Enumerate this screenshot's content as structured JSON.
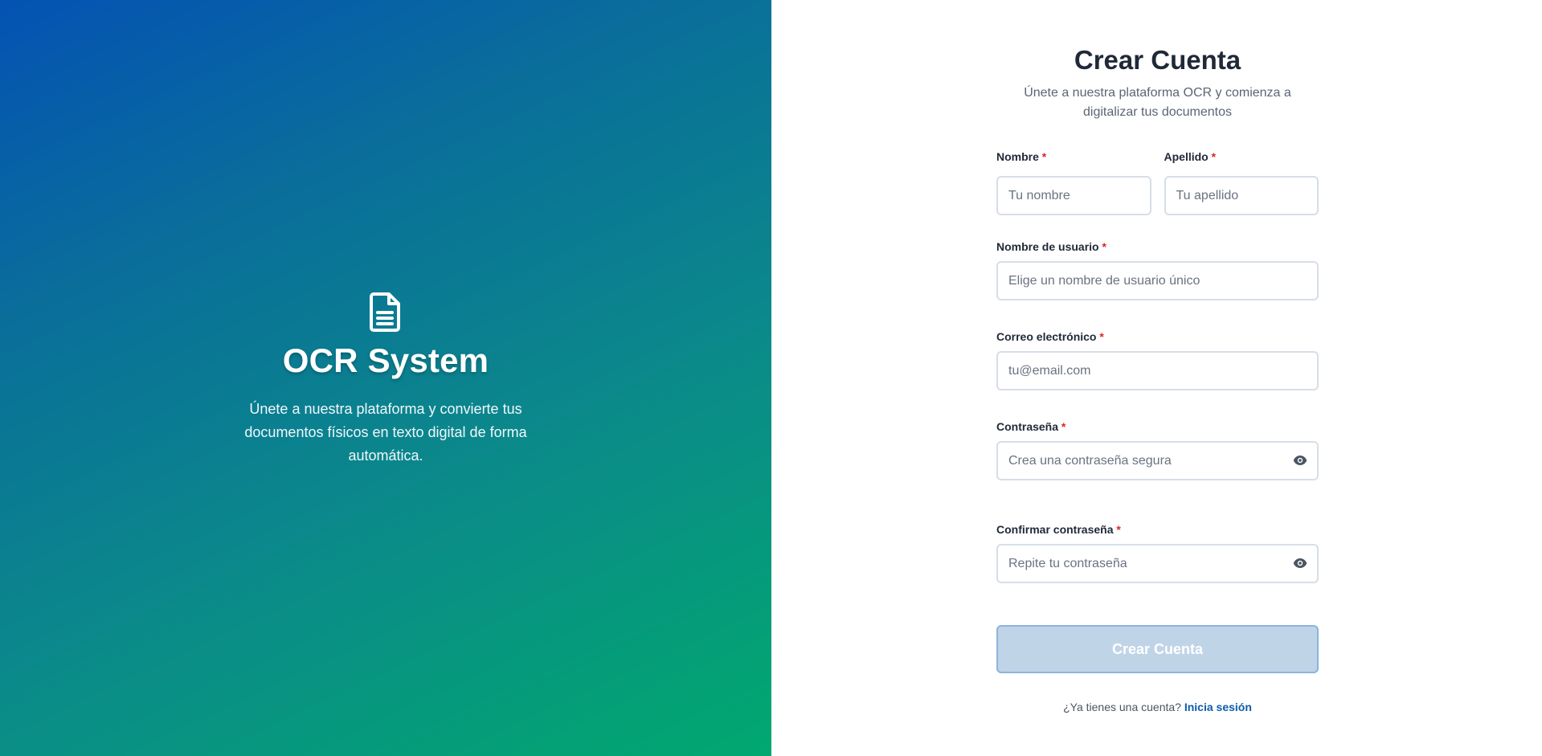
{
  "hero": {
    "title": "OCR System",
    "description": "Únete a nuestra plataforma y convierte tus documentos físicos en texto digital de forma automática.",
    "icon": "document-icon"
  },
  "form": {
    "title": "Crear Cuenta",
    "subtitle": "Únete a nuestra plataforma OCR y comienza a digitalizar tus documentos",
    "required_mark": "*",
    "first_name": {
      "label": "Nombre",
      "placeholder": "Tu nombre"
    },
    "last_name": {
      "label": "Apellido",
      "placeholder": "Tu apellido"
    },
    "username": {
      "label": "Nombre de usuario",
      "placeholder": "Elige un nombre de usuario único"
    },
    "email": {
      "label": "Correo electrónico",
      "placeholder": "tu@email.com"
    },
    "password": {
      "label": "Contraseña",
      "placeholder": "Crea una contraseña segura",
      "icon": "eye-icon"
    },
    "confirm_password": {
      "label": "Confirmar contraseña",
      "placeholder": "Repite tu contraseña",
      "icon": "eye-icon"
    },
    "submit_label": "Crear Cuenta",
    "login_prompt": "¿Ya tienes una cuenta?",
    "login_link": "Inicia sesión"
  },
  "colors": {
    "gradient_start": "#0452b3",
    "gradient_end": "#01a86f",
    "required": "#dc2626",
    "link": "#0d5ca8",
    "button_disabled": "#c0d4e8"
  }
}
